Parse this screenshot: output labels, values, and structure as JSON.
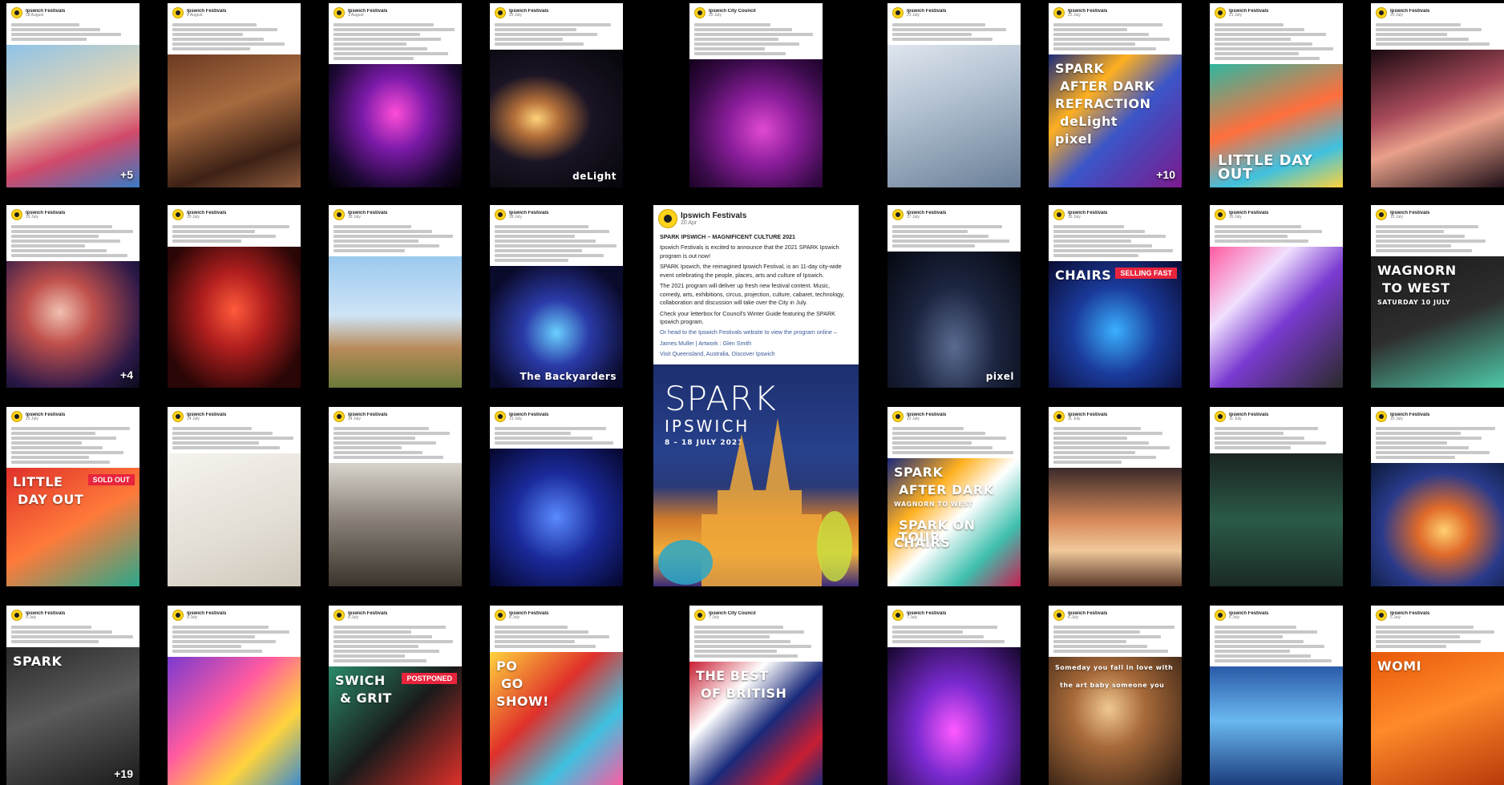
{
  "page": "Ipswich Festivals social media posts",
  "featured_post": {
    "page_name": "Ipswich Festivals",
    "date": "20 Apr",
    "headline": "SPARK IPSWICH – MAGNIFICENT CULTURE 2021",
    "paragraphs": [
      "Ipswich Festivals is excited to announce that the 2021 SPARK Ipswich program is out now!",
      "SPARK Ipswich, the reimagined Ipswich Festival, is an 11-day city-wide event celebrating the people, places, arts and culture of Ipswich.",
      "The 2021 program will deliver up fresh new festival content. Music, comedy, arts, exhibitions, circus, projection, culture, cabaret, technology, collaboration and discussion will take over the City in July.",
      "Check your letterbox for Council's Winter Guide featuring the SPARK Ipswich program.",
      "Or head to the Ipswich Festivals website to view the program online –",
      "James Muller | Artwork : Glen Smith",
      "Visit Queensland, Australia, Discover Ipswich"
    ],
    "poster": {
      "title": "SPARK",
      "subtitle": "IPSWICH",
      "dates": "8 – 18 JULY 2021"
    }
  },
  "posts": [
    {
      "page_name": "Ipswich Festivals",
      "date": "18 August",
      "media": "kids-festival",
      "plus": "+5"
    },
    {
      "page_name": "Ipswich Festivals",
      "date": "8 August",
      "media": "workshop"
    },
    {
      "page_name": "Ipswich Festivals",
      "date": "1 August",
      "media": "church-purple"
    },
    {
      "page_name": "Ipswich Festivals",
      "date": "25 July",
      "media": "cathedral-night",
      "caption": "deLight"
    },
    {
      "page_name": "Ipswich City Council",
      "date": "25 July",
      "media": "octopus-purple"
    },
    {
      "page_name": "Ipswich Festivals",
      "date": "23 July",
      "media": "tshirt-girl"
    },
    {
      "page_name": "Ipswich Festivals",
      "date": "22 July",
      "media": "spark-collage",
      "captions": [
        "SPARK",
        "AFTER DARK",
        "REFRACTION",
        "deLight",
        "pixel"
      ],
      "plus": "+10"
    },
    {
      "page_name": "Ipswich Festivals",
      "date": "21 July",
      "media": "little-day-out",
      "caption": "LITTLE DAY OUT"
    },
    {
      "page_name": "Ipswich Festivals",
      "date": "20 July",
      "media": "dancers"
    },
    {
      "page_name": "Ipswich Festivals",
      "date": "19 July",
      "media": "singer",
      "plus": "+4"
    },
    {
      "page_name": "Ipswich Festivals",
      "date": "19 July",
      "media": "stage-red"
    },
    {
      "page_name": "Ipswich Festivals",
      "date": "18 July",
      "media": "arch-field"
    },
    {
      "page_name": "Ipswich Festivals",
      "date": "18 July",
      "media": "concert-night",
      "caption": "The Backyarders"
    },
    {
      "page_name": "Ipswich Festivals",
      "date": "17 July",
      "media": "pixel-dome",
      "caption": "pixel"
    },
    {
      "page_name": "Ipswich Festivals",
      "date": "16 July",
      "media": "chairs-show",
      "captions": [
        "CHAIRS",
        "SELLING FAST"
      ]
    },
    {
      "page_name": "Ipswich Festivals",
      "date": "16 July",
      "media": "faces-collage"
    },
    {
      "page_name": "Ipswich Festivals",
      "date": "15 July",
      "media": "wagnorn",
      "captions": [
        "WAGNORN",
        "TO WEST",
        "SATURDAY 10 JULY"
      ]
    },
    {
      "page_name": "Ipswich Festivals",
      "date": "15 July",
      "media": "little-day-out-red",
      "captions": [
        "LITTLE",
        "DAY OUT",
        "SOLD OUT"
      ]
    },
    {
      "page_name": "Ipswich Festivals",
      "date": "14 July",
      "media": "sketch-dancers"
    },
    {
      "page_name": "Ipswich Festivals",
      "date": "14 July",
      "media": "church-interior"
    },
    {
      "page_name": "Ipswich Festivals",
      "date": "13 July",
      "media": "acrobat-blue"
    },
    {
      "page_name": "Ipswich Festivals",
      "date": "12 July",
      "media": "spark-grid",
      "captions": [
        "SPARK",
        "AFTER DARK",
        "WAGNORN TO WEST",
        "SPARK ON TOUR",
        "CHAIRS"
      ]
    },
    {
      "page_name": "Ipswich Festivals",
      "date": "11 July",
      "media": "womi-performers"
    },
    {
      "page_name": "Ipswich Festivals",
      "date": "11 July",
      "media": "green-stage"
    },
    {
      "page_name": "Ipswich Festivals",
      "date": "10 July",
      "media": "cathedral-lights"
    },
    {
      "page_name": "Ipswich Festivals",
      "date": "9 July",
      "media": "spark-launch",
      "captions": [
        "SPARK"
      ],
      "plus": "+19"
    },
    {
      "page_name": "Ipswich Festivals",
      "date": "9 July",
      "media": "clowns"
    },
    {
      "page_name": "Ipswich Festivals",
      "date": "8 July",
      "media": "swich-grit",
      "captions": [
        "SWICH",
        "& GRIT",
        "POSTPONED"
      ]
    },
    {
      "page_name": "Ipswich Festivals",
      "date": "8 July",
      "media": "popogo",
      "captions": [
        "PO",
        "GO",
        "SHOW!"
      ]
    },
    {
      "page_name": "Ipswich City Council",
      "date": "7 July",
      "media": "best-of-british",
      "captions": [
        "THE BEST",
        "OF BRITISH"
      ]
    },
    {
      "page_name": "Ipswich Festivals",
      "date": "7 July",
      "media": "purple-stage"
    },
    {
      "page_name": "Ipswich Festivals",
      "date": "6 July",
      "media": "singer-subtitle",
      "captions": [
        "Someday you fall in love with",
        "the art baby someone you"
      ]
    },
    {
      "page_name": "Ipswich Festivals",
      "date": "6 July",
      "media": "bubble-performers"
    },
    {
      "page_name": "Ipswich Festivals",
      "date": "5 July",
      "media": "womi-video",
      "captions": [
        "WOMI"
      ]
    }
  ]
}
